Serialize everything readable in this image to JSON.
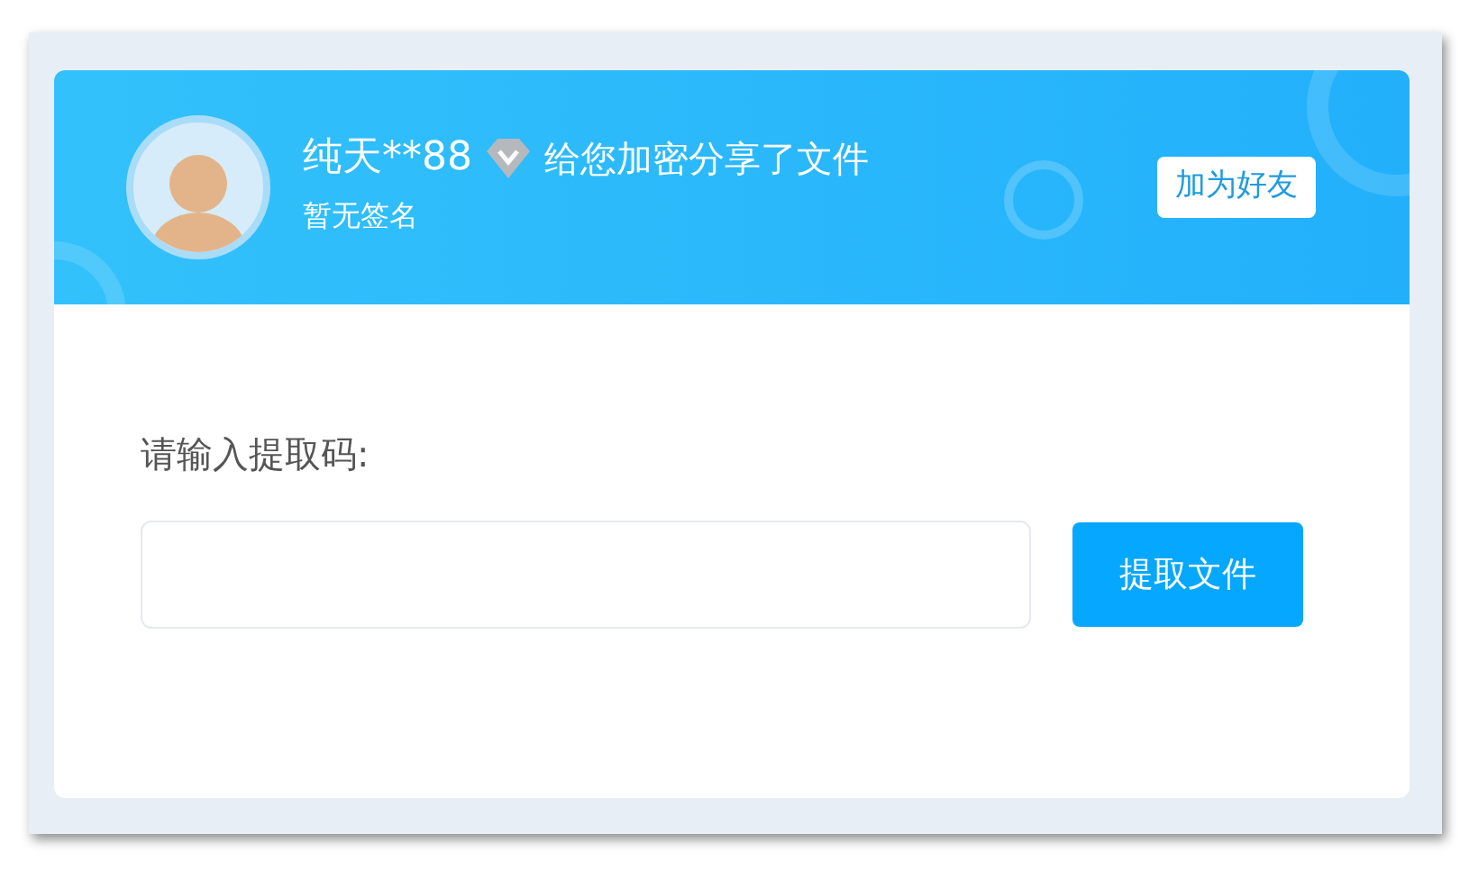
{
  "header": {
    "user_name": "纯天**88",
    "message": "给您加密分享了文件",
    "signature": "暂无签名",
    "add_friend_button": "加为好友"
  },
  "form": {
    "label": "请输入提取码:"
  },
  "submit_button": "提取文件"
}
